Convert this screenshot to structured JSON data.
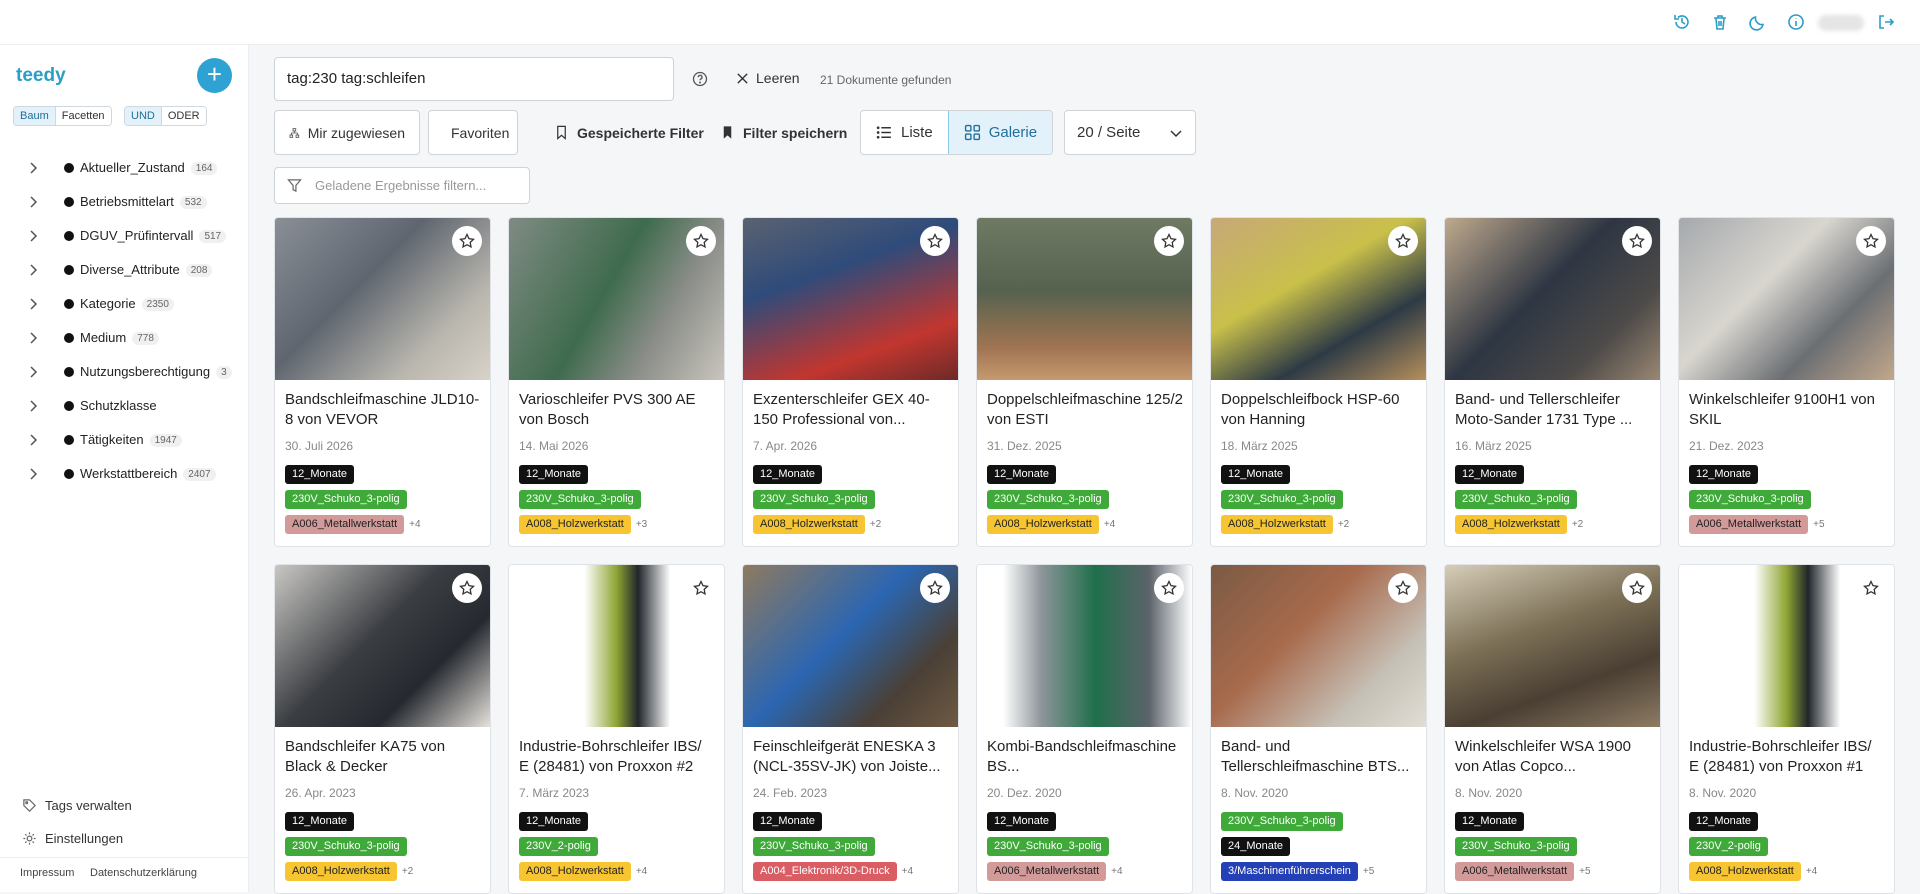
{
  "sidebar": {
    "logo": "teedy",
    "add_label": "+",
    "mode_tabs": [
      "Baum",
      "Facetten"
    ],
    "logic_tabs": [
      "UND",
      "ODER"
    ],
    "tree": [
      {
        "label": "Aktueller_Zustand",
        "count": "164"
      },
      {
        "label": "Betriebsmittelart",
        "count": "532"
      },
      {
        "label": "DGUV_Prüfintervall",
        "count": "517"
      },
      {
        "label": "Diverse_Attribute",
        "count": "208"
      },
      {
        "label": "Kategorie",
        "count": "2350"
      },
      {
        "label": "Medium",
        "count": "778"
      },
      {
        "label": "Nutzungsberechtigung",
        "count": "3"
      },
      {
        "label": "Schutzklasse",
        "count": ""
      },
      {
        "label": "Tätigkeiten",
        "count": "1947"
      },
      {
        "label": "Werkstattbereich",
        "count": "2407"
      }
    ],
    "manage_tags": "Tags verwalten",
    "settings": "Einstellungen",
    "footer": [
      "Impressum",
      "Datenschutzerklärung"
    ]
  },
  "search": {
    "query": "tag:230 tag:schleifen",
    "clear_label": "Leeren",
    "result_count": "21 Dokumente gefunden"
  },
  "toolbar": {
    "assigned": "Mir zugewiesen",
    "favorites": "Favoriten",
    "saved_filters": "Gespeicherte Filter",
    "save_filter": "Filter speichern",
    "list": "Liste",
    "gallery": "Galerie",
    "page_size": "20 / Seite",
    "filter_placeholder": "Geladene Ergebnisse filtern..."
  },
  "colors": {
    "accent": "#2b9ec7",
    "tag_black": "#111111",
    "tag_green": "#3fa93a",
    "tag_yellow": "#f7c531",
    "tag_rose": "#d39a9a",
    "tag_red": "#d95d63",
    "tag_blue": "#2340b6"
  },
  "cards": [
    {
      "title": "Bandschleifmaschine JLD10-8 von VEVOR",
      "date": "30. Juli 2026",
      "tags": [
        [
          "12_Monate",
          "black"
        ],
        [
          "230V_Schuko_3-polig",
          "green"
        ],
        [
          "A006_Metallwerkstatt",
          "rose"
        ]
      ],
      "more": "+4"
    },
    {
      "title": "Varioschleifer PVS 300 AE von Bosch",
      "date": "14. Mai 2026",
      "tags": [
        [
          "12_Monate",
          "black"
        ],
        [
          "230V_Schuko_3-polig",
          "green"
        ],
        [
          "A008_Holzwerkstatt",
          "yellow"
        ]
      ],
      "more": "+3"
    },
    {
      "title": "Exzenterschleifer GEX 40-150 Professional von...",
      "date": "7. Apr. 2026",
      "tags": [
        [
          "12_Monate",
          "black"
        ],
        [
          "230V_Schuko_3-polig",
          "green"
        ],
        [
          "A008_Holzwerkstatt",
          "yellow"
        ]
      ],
      "more": "+2"
    },
    {
      "title": "Doppelschleifmaschine 125/2 von ESTI",
      "date": "31. Dez. 2025",
      "tags": [
        [
          "12_Monate",
          "black"
        ],
        [
          "230V_Schuko_3-polig",
          "green"
        ],
        [
          "A008_Holzwerkstatt",
          "yellow"
        ]
      ],
      "more": "+4"
    },
    {
      "title": "Doppelschleifbock HSP-60 von Hanning",
      "date": "18. März 2025",
      "tags": [
        [
          "12_Monate",
          "black"
        ],
        [
          "230V_Schuko_3-polig",
          "green"
        ],
        [
          "A008_Holzwerkstatt",
          "yellow"
        ]
      ],
      "more": "+2"
    },
    {
      "title": "Band- und Tellerschleifer Moto-Sander 1731 Type ...",
      "date": "16. März 2025",
      "tags": [
        [
          "12_Monate",
          "black"
        ],
        [
          "230V_Schuko_3-polig",
          "green"
        ],
        [
          "A008_Holzwerkstatt",
          "yellow"
        ]
      ],
      "more": "+2"
    },
    {
      "title": "Winkelschleifer 9100H1 von SKIL",
      "date": "21. Dez. 2023",
      "tags": [
        [
          "12_Monate",
          "black"
        ],
        [
          "230V_Schuko_3-polig",
          "green"
        ],
        [
          "A006_Metallwerkstatt",
          "rose"
        ]
      ],
      "more": "+5"
    },
    {
      "title": "Bandschleifer KA75 von Black & Decker",
      "date": "26. Apr. 2023",
      "tags": [
        [
          "12_Monate",
          "black"
        ],
        [
          "230V_Schuko_3-polig",
          "green"
        ],
        [
          "A008_Holzwerkstatt",
          "yellow"
        ]
      ],
      "more": "+2"
    },
    {
      "title": "Industrie-Bohrschleifer IBS/ E (28481) von Proxxon #2",
      "date": "7. März 2023",
      "tags": [
        [
          "12_Monate",
          "black"
        ],
        [
          "230V_2-polig",
          "green"
        ],
        [
          "A008_Holzwerkstatt",
          "yellow"
        ]
      ],
      "more": "+4"
    },
    {
      "title": "Feinschleifgerät ENESKA 3 (NCL-35SV-JK) von Joiste...",
      "date": "24. Feb. 2023",
      "tags": [
        [
          "12_Monate",
          "black"
        ],
        [
          "230V_Schuko_3-polig",
          "green"
        ],
        [
          "A004_Elektronik/3D-Druck",
          "red"
        ]
      ],
      "more": "+4"
    },
    {
      "title": "Kombi-Bandschleifmaschine BS...",
      "date": "20. Dez. 2020",
      "tags": [
        [
          "12_Monate",
          "black"
        ],
        [
          "230V_Schuko_3-polig",
          "green"
        ],
        [
          "A006_Metallwerkstatt",
          "rose"
        ]
      ],
      "more": "+4"
    },
    {
      "title": "Band- und Tellerschleifmaschine BTS...",
      "date": "8. Nov. 2020",
      "tags": [
        [
          "230V_Schuko_3-polig",
          "green"
        ],
        [
          "24_Monate",
          "black"
        ],
        [
          "3/Maschinenführerschein",
          "blue"
        ]
      ],
      "more": "+5"
    },
    {
      "title": "Winkelschleifer WSA 1900 von Atlas Copco...",
      "date": "8. Nov. 2020",
      "tags": [
        [
          "12_Monate",
          "black"
        ],
        [
          "230V_Schuko_3-polig",
          "green"
        ],
        [
          "A006_Metallwerkstatt",
          "rose"
        ]
      ],
      "more": "+5"
    },
    {
      "title": "Industrie-Bohrschleifer IBS/ E (28481) von Proxxon #1",
      "date": "8. Nov. 2020",
      "tags": [
        [
          "12_Monate",
          "black"
        ],
        [
          "230V_2-polig",
          "green"
        ],
        [
          "A008_Holzwerkstatt",
          "yellow"
        ]
      ],
      "more": "+4"
    }
  ]
}
